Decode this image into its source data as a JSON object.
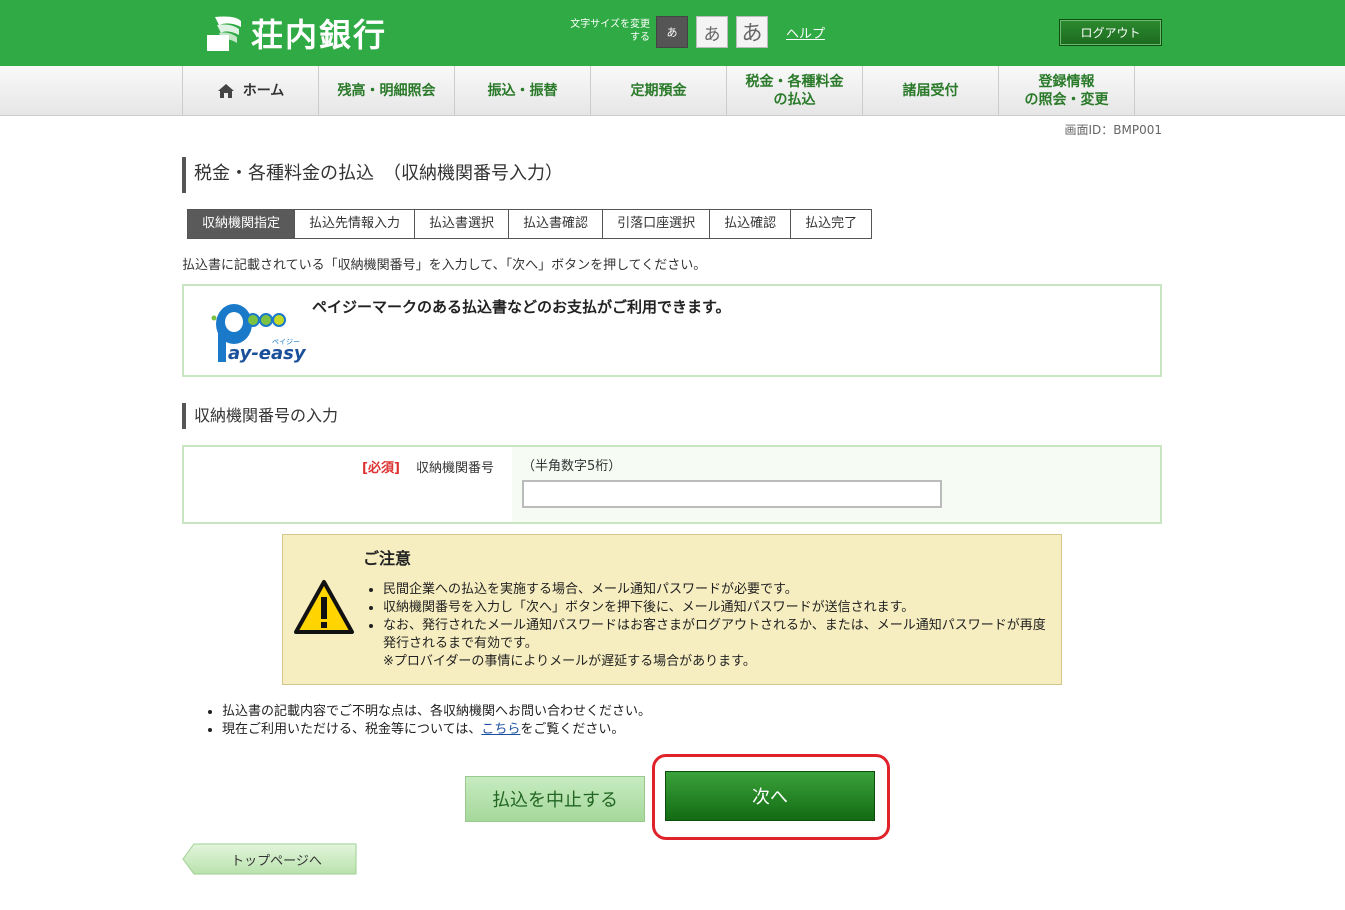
{
  "header": {
    "bank_name": "荘内銀行",
    "fontsize_label": "文字サイズを変更する",
    "fontsize_small": "あ",
    "fontsize_mid": "あ",
    "fontsize_large": "あ",
    "help": "ヘルプ",
    "logout": "ログアウト"
  },
  "nav": {
    "items": [
      {
        "label": "ホーム"
      },
      {
        "label": "残高・明細照会"
      },
      {
        "label": "振込・振替"
      },
      {
        "label": "定期預金"
      },
      {
        "label_line1": "税金・各種料金",
        "label_line2": "の払込"
      },
      {
        "label": "諸届受付"
      },
      {
        "label_line1": "登録情報",
        "label_line2": "の照会・変更"
      }
    ]
  },
  "screen_id": "画面ID：BMP001",
  "page_title": "税金・各種料金の払込　（収納機関番号入力）",
  "steps": [
    "収納機関指定",
    "払込先情報入力",
    "払込書選択",
    "払込書確認",
    "引落口座選択",
    "払込確認",
    "払込完了"
  ],
  "instruction": "払込書に記載されている「収納機関番号」を入力して、「次へ」ボタンを押してください。",
  "payeasy": {
    "logo_text": "ay-easy",
    "logo_sub": "ペイジー",
    "message": "ペイジーマークのある払込書などのお支払がご利用できます。"
  },
  "section_title": "収納機関番号の入力",
  "form": {
    "required": "[必須]",
    "label": "収納機関番号",
    "hint": "（半角数字5桁）",
    "value": ""
  },
  "notice": {
    "title": "ご注意",
    "items": [
      "民間企業への払込を実施する場合、メール通知パスワードが必要です。",
      "収納機関番号を入力し「次へ」ボタンを押下後に、メール通知パスワードが送信されます。",
      "なお、発行されたメール通知パスワードはお客さまがログアウトされるか、または、メール通知パスワードが再度発行されるまで有効です。"
    ],
    "sub_note": "※プロバイダーの事情によりメールが遅延する場合があります。"
  },
  "footer_notes": {
    "note1": "払込書の記載内容でご不明な点は、各収納機関へお問い合わせください。",
    "note2_before": "現在ご利用いただける、税金等については、",
    "note2_link": "こちら",
    "note2_after": "をご覧ください。"
  },
  "buttons": {
    "cancel": "払込を中止する",
    "next": "次へ",
    "top_page": "トップページへ"
  },
  "colors": {
    "brand_green": "#2faa44",
    "highlight_red": "#e0232b",
    "required_red": "#dd3333"
  }
}
